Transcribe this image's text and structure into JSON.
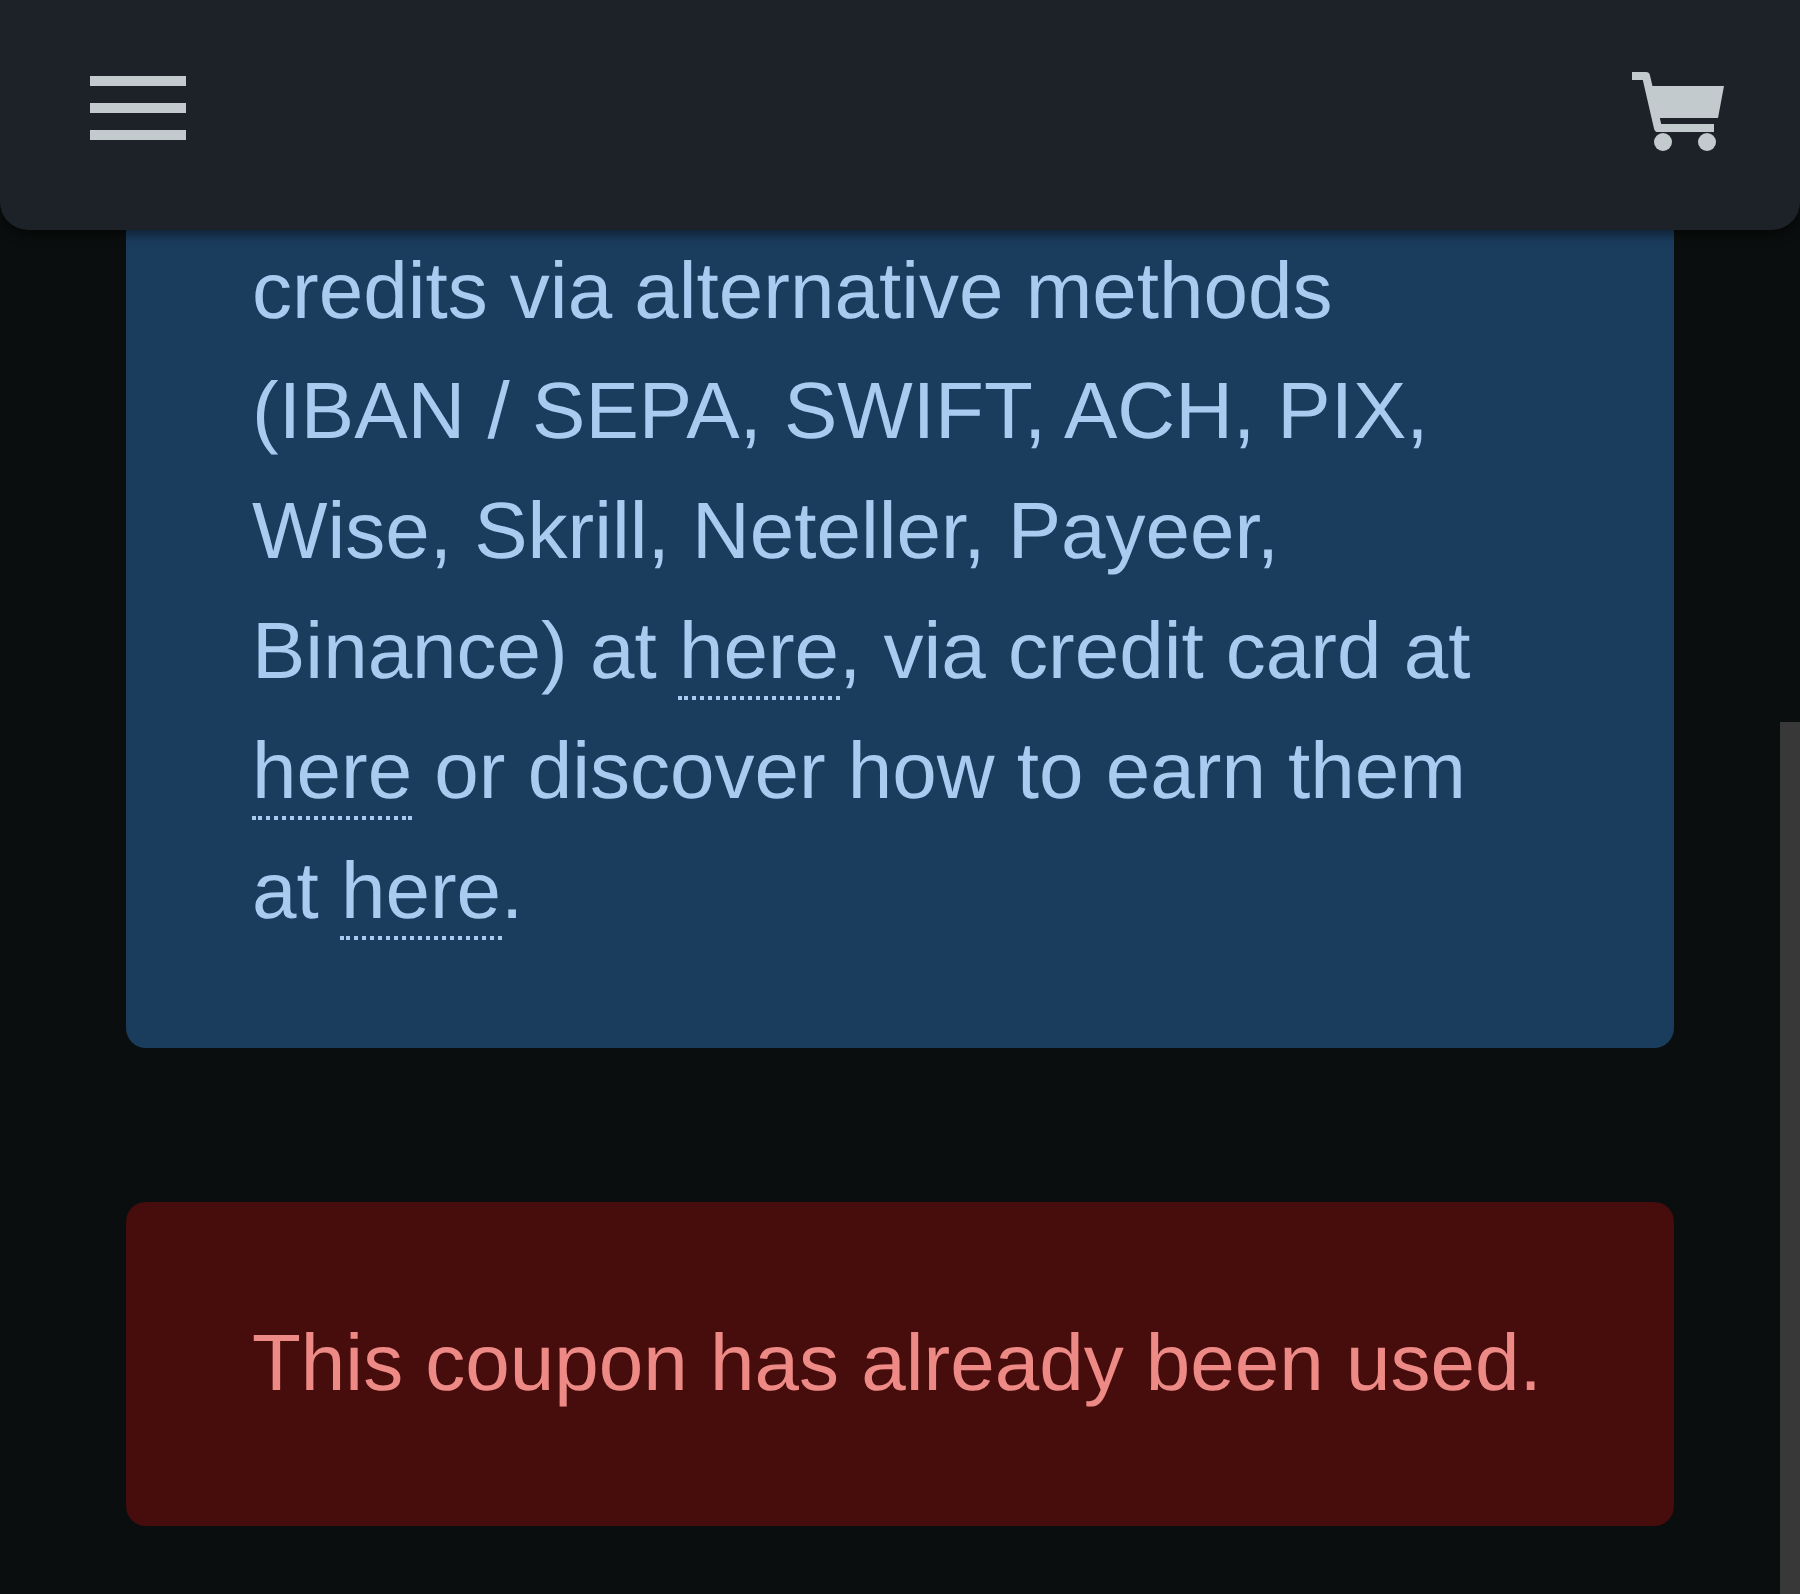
{
  "info_notice": {
    "segments": [
      {
        "kind": "text",
        "text": "credits via alternative methods (IBAN / SEPA, SWIFT, ACH, PIX, Wise, Skrill, Neteller, Payeer, Binance) at "
      },
      {
        "kind": "link",
        "text": "here"
      },
      {
        "kind": "text",
        "text": ", via credit card at "
      },
      {
        "kind": "link",
        "text": "here"
      },
      {
        "kind": "text",
        "text": " or discover how to earn them at "
      },
      {
        "kind": "link",
        "text": "here"
      },
      {
        "kind": "text",
        "text": "."
      }
    ]
  },
  "error_alert": {
    "message": "This coupon has already been used."
  }
}
